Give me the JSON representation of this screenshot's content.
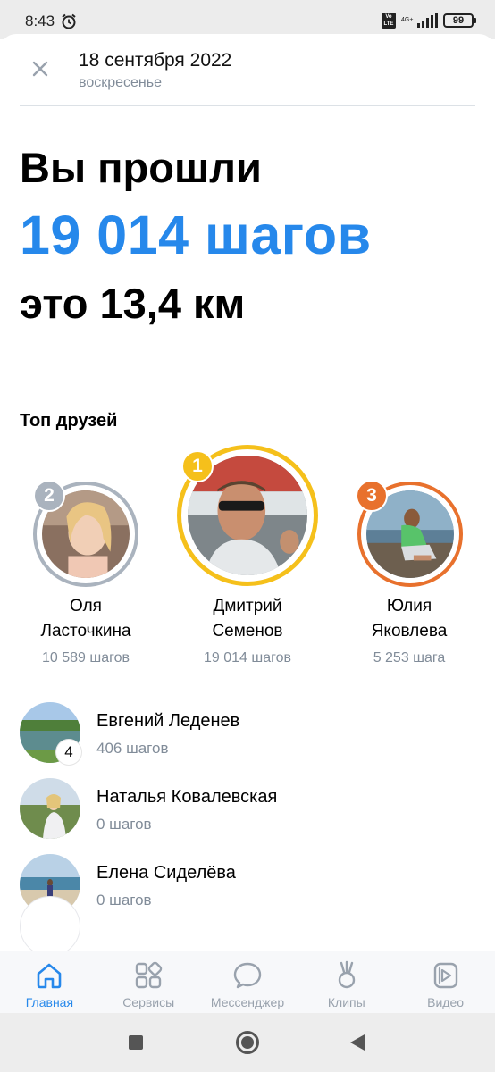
{
  "status": {
    "time": "8:43",
    "volte": "Vo LTE",
    "network": "4G+",
    "battery": "99"
  },
  "header": {
    "date": "18 сентября 2022",
    "weekday": "воскресенье"
  },
  "summary": {
    "line1": "Вы прошли",
    "steps": "19 014 шагов",
    "distance": "это 13,4 км"
  },
  "top_friends": {
    "title": "Топ друзей",
    "podium": [
      {
        "rank": "2",
        "name": "Оля\nЛасточкина",
        "steps": "10 589 шагов",
        "color": "#aab3be"
      },
      {
        "rank": "1",
        "name": "Дмитрий\nСеменов",
        "steps": "19 014 шагов",
        "color": "#f5c01b"
      },
      {
        "rank": "3",
        "name": "Юлия\nЯковлева",
        "steps": "5 253 шага",
        "color": "#e8712d"
      }
    ],
    "list": [
      {
        "rank": "4",
        "name": "Евгений Леденев",
        "steps": "406 шагов"
      },
      {
        "name": "Наталья Ковалевская",
        "steps": "0 шагов"
      },
      {
        "name": "Елена Сиделёва",
        "steps": "0 шагов"
      }
    ]
  },
  "tabs": [
    {
      "label": "Главная",
      "icon": "home-icon",
      "active": true
    },
    {
      "label": "Сервисы",
      "icon": "services-icon"
    },
    {
      "label": "Мессенджер",
      "icon": "messenger-icon"
    },
    {
      "label": "Клипы",
      "icon": "clips-icon"
    },
    {
      "label": "Видео",
      "icon": "video-icon"
    }
  ],
  "colors": {
    "accent": "#2688eb",
    "secondary_text": "#818c99",
    "gold": "#f5c01b",
    "silver": "#aab3be",
    "bronze": "#e8712d"
  }
}
